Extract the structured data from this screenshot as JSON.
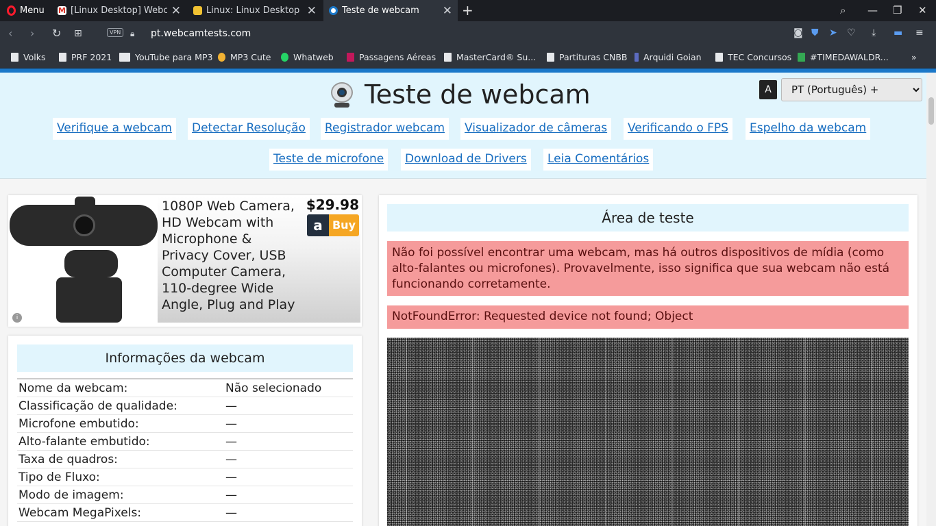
{
  "browser": {
    "menu_label": "Menu",
    "tabs": [
      {
        "title": "[Linux Desktop] Webcam não funciona"
      },
      {
        "title": "Linux: Linux Desktop [Comunidade]"
      },
      {
        "title": "Teste de webcam"
      }
    ],
    "address": {
      "host": "pt.webcamtests.com",
      "vpn_label": "VPN"
    },
    "bookmarks": [
      "Volks",
      "PRF 2021",
      "YouTube para MP3",
      "MP3 Cute",
      "Whatweb",
      "Passagens Aéreas",
      "MasterCard® Su...",
      "Partituras CNBB",
      "Arquidi Goian",
      "TEC Concursos",
      "#TIMEDAWALDR..."
    ]
  },
  "header": {
    "title": "Teste de webcam",
    "language_selected": "PT (Português) +",
    "nav": [
      "Verifique a webcam",
      "Detectar Resolução",
      "Registrador webcam",
      "Visualizador de câmeras",
      "Verificando o FPS",
      "Espelho da webcam",
      "Teste de microfone",
      "Download de Drivers",
      "Leia Comentários"
    ]
  },
  "ad": {
    "title": "1080P Web Camera, HD Webcam with Microphone & Privacy Cover, USB Computer Camera, 110-degree Wide Angle, Plug and Play",
    "price": "$29.98",
    "buy_label": "Buy",
    "info_label": "i"
  },
  "info": {
    "heading": "Informações da webcam",
    "rows": [
      {
        "k": "Nome da webcam:",
        "v": "Não selecionado"
      },
      {
        "k": "Classificação de qualidade:",
        "v": "—"
      },
      {
        "k": "Microfone embutido:",
        "v": "—"
      },
      {
        "k": "Alto-falante embutido:",
        "v": "—"
      },
      {
        "k": "Taxa de quadros:",
        "v": "—"
      },
      {
        "k": "Tipo de Fluxo:",
        "v": "—"
      },
      {
        "k": "Modo de imagem:",
        "v": "—"
      },
      {
        "k": "Webcam MegaPixels:",
        "v": "—"
      }
    ]
  },
  "test": {
    "heading": "Área de teste",
    "error1": "Não foi possível encontrar uma webcam, mas há outros dispositivos de mídia (como alto-falantes ou microfones). Provavelmente, isso significa que sua webcam não está funcionando corretamente.",
    "error2": "NotFoundError: Requested device not found; Object"
  },
  "colors": {
    "accent": "#1b78c9",
    "link": "#1a6fc1",
    "header_bg": "#e1f5fd",
    "error_bg": "#f59b9b"
  }
}
